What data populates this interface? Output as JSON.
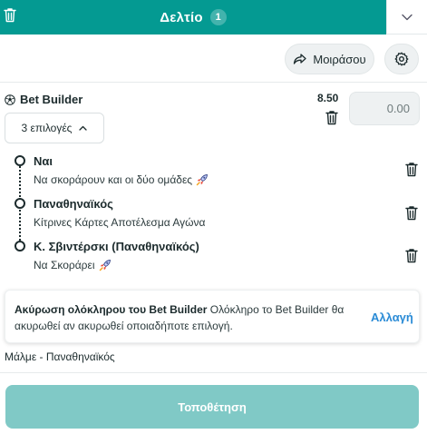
{
  "header": {
    "title": "Δελτίο",
    "count": "1",
    "accent_color": "#049a92"
  },
  "toolbar": {
    "share_label": "Μοιράσου"
  },
  "bet_builder": {
    "title": "Bet Builder",
    "odds": "8.50",
    "stake_placeholder": "0.00",
    "selections_toggle": "3 επιλογές",
    "selections": [
      {
        "title": "Ναι",
        "subtitle": "Να σκοράρουν και οι δύο ομάδες",
        "icon": "rocket-icon"
      },
      {
        "title": "Παναθηναϊκός",
        "subtitle": "Κίτρινες Κάρτες Αποτέλεσμα Αγώνα",
        "icon": ""
      },
      {
        "title": "Κ. Σβιντέρσκι (Παναθηναϊκός)",
        "subtitle": "Να Σκοράρει",
        "icon": "rocket-icon"
      }
    ]
  },
  "info": {
    "strong": "Ακύρωση ολόκληρου του Bet Builder",
    "text": " Ολόκληρο το Bet Builder θα ακυρωθεί αν ακυρωθεί οποιαδήποτε επιλογή.",
    "change_label": "Αλλαγή",
    "link_color": "#2a8bd6"
  },
  "match": "Μάλμε - Παναθηναϊκός",
  "place_button": "Τοποθέτηση"
}
